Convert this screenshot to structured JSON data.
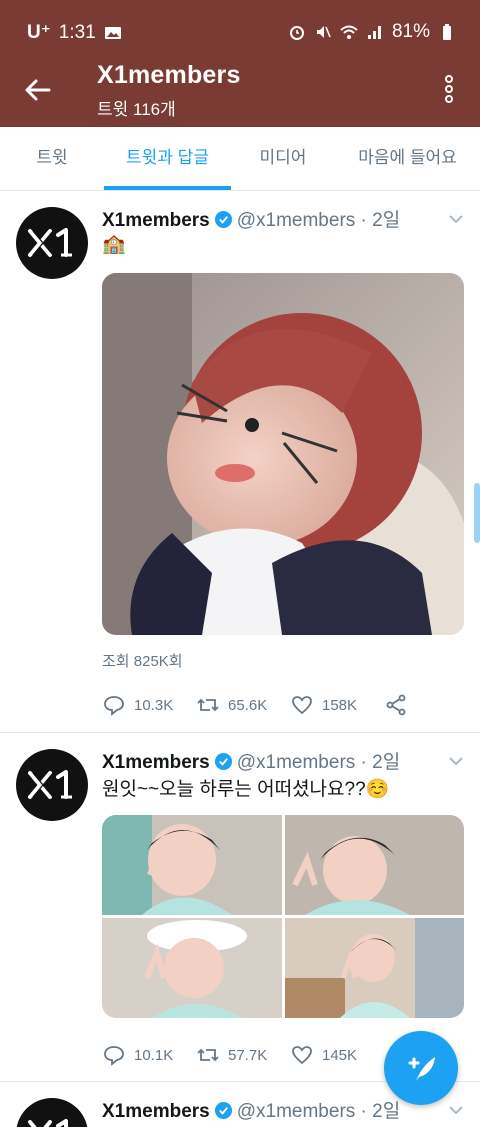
{
  "status_bar": {
    "carrier": "U⁺",
    "time": "1:31",
    "battery": "81%"
  },
  "header": {
    "title": "X1members",
    "subtitle": "트윗 116개"
  },
  "tabs": [
    {
      "label": "트윗"
    },
    {
      "label": "트윗과 답글"
    },
    {
      "label": "미디어"
    },
    {
      "label": "마음에 들어요"
    }
  ],
  "tweets": [
    {
      "name": "X1members",
      "handle": "@x1members · 2일",
      "text": "🏫",
      "views": "조회 825K회",
      "replies": "10.3K",
      "retweets": "65.6K",
      "likes": "158K"
    },
    {
      "name": "X1members",
      "handle": "@x1members · 2일",
      "text": "원잇~~오늘 하루는 어떠셨나요??☺️",
      "replies": "10.1K",
      "retweets": "57.7K",
      "likes": "145K"
    },
    {
      "name": "X1members",
      "handle": "@x1members · 2일"
    }
  ],
  "colors": {
    "header_bg": "#7a3b34",
    "accent": "#1da1f2",
    "muted": "#657786"
  }
}
